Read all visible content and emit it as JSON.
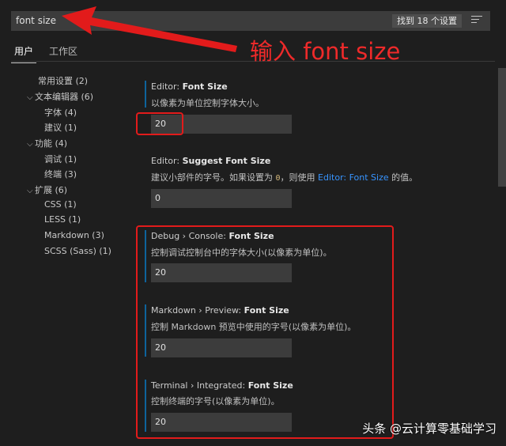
{
  "search": {
    "value": "font size",
    "result_count": "找到 18 个设置",
    "filter_icon": "filter-list-icon"
  },
  "tabs": [
    {
      "label": "用户"
    },
    {
      "label": "工作区"
    }
  ],
  "toc": [
    {
      "label": "常用设置 (2)"
    },
    {
      "label": "文本编辑器 (6)",
      "expanded": true
    },
    {
      "label": "字体 (4)"
    },
    {
      "label": "建议 (1)"
    },
    {
      "label": "功能 (4)",
      "expanded": true
    },
    {
      "label": "调试 (1)"
    },
    {
      "label": "终端 (3)"
    },
    {
      "label": "扩展 (6)",
      "expanded": true
    },
    {
      "label": "CSS (1)"
    },
    {
      "label": "LESS (1)"
    },
    {
      "label": "Markdown (3)"
    },
    {
      "label": "SCSS (Sass) (1)"
    }
  ],
  "settings": [
    {
      "category": "Editor: ",
      "name": "Font Size",
      "description": "以像素为单位控制字体大小。",
      "value": "20"
    },
    {
      "category": "Editor: ",
      "name": "Suggest Font Size",
      "desc_before": "建议小部件的字号。如果设置为 ",
      "desc_code": "0",
      "desc_mid": "，则使用 ",
      "desc_link": "Editor: Font Size",
      "desc_after": " 的值。",
      "value": "0"
    },
    {
      "category": "Debug › Console: ",
      "name": "Font Size",
      "description": "控制调试控制台中的字体大小(以像素为单位)。",
      "value": "20"
    },
    {
      "category": "Markdown › Preview: ",
      "name": "Font Size",
      "description": "控制 Markdown 预览中使用的字号(以像素为单位)。",
      "value": "20"
    },
    {
      "category": "Terminal › Integrated: ",
      "name": "Font Size",
      "description": "控制终端的字号(以像素为单位)。",
      "value": "20"
    }
  ],
  "annotation": {
    "text": "输入  font size",
    "color": "#e21b1b"
  },
  "watermark": "头条 @云计算零基础学习",
  "colors": {
    "background": "#1e1e1e",
    "input": "#3c3c3c",
    "accent": "#0e639c",
    "link": "#3794ff",
    "annotation_red": "#e21b1b"
  }
}
